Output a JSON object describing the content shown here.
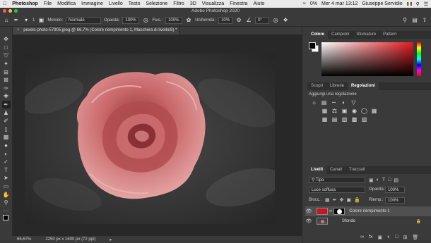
{
  "menubar": {
    "apple": "",
    "app": "Photoshop",
    "items": [
      "File",
      "Modifica",
      "Immagine",
      "Livello",
      "Testo",
      "Selezione",
      "Filtro",
      "3D",
      "Visualizza",
      "Finestra",
      "Aiuto"
    ],
    "status_right": {
      "percent": "0%",
      "datetime": "Mer 4 mar 13:12",
      "user": "Giuseppe Servidio"
    }
  },
  "titlebar": {
    "title": "Adobe Photoshop 2020"
  },
  "options": {
    "brush_size": "1",
    "metodo_label": "Metodo:",
    "metodo_value": "Normale",
    "opacita_label": "Opacità:",
    "opacita_value": "100%",
    "flusso_label": "Flus.:",
    "flusso_value": "100%",
    "uniformita_label": "Uniformità:",
    "uniformita_value": "10%",
    "angle_value": "0°"
  },
  "doctab": {
    "label": "pexels-photo-57905.jpeg @ 66,7% (Colore riempimento 1, Maschera di livello/8) *"
  },
  "status": {
    "zoom": "66,67%",
    "size": "2250 px x 1600 px (72 ppi)"
  },
  "panels": {
    "color_tabs": [
      "Colore",
      "Campioni",
      "Sfumature",
      "Pattern"
    ],
    "mid_tabs": [
      "Scopri",
      "Librerie",
      "Regolazioni"
    ],
    "adj_title": "Aggiungi una regolazione",
    "layer_tabs": [
      "Livelli",
      "Canali",
      "Tracciati"
    ],
    "filter_label": "Tipo",
    "blend_mode": "Luce soffusa",
    "opacity_label": "Opacità:",
    "opacity_value": "100%",
    "lock_label": "Blocc.:",
    "fill_label": "Riemp.:",
    "fill_value": "100%",
    "layers": [
      {
        "name": "Colore riempimento 1",
        "selected": true,
        "color": "#c8141c"
      },
      {
        "name": "Sfondo",
        "selected": false
      }
    ]
  },
  "colors": {
    "accent_red": "#e21b22",
    "fill_layer": "#c8141c"
  }
}
